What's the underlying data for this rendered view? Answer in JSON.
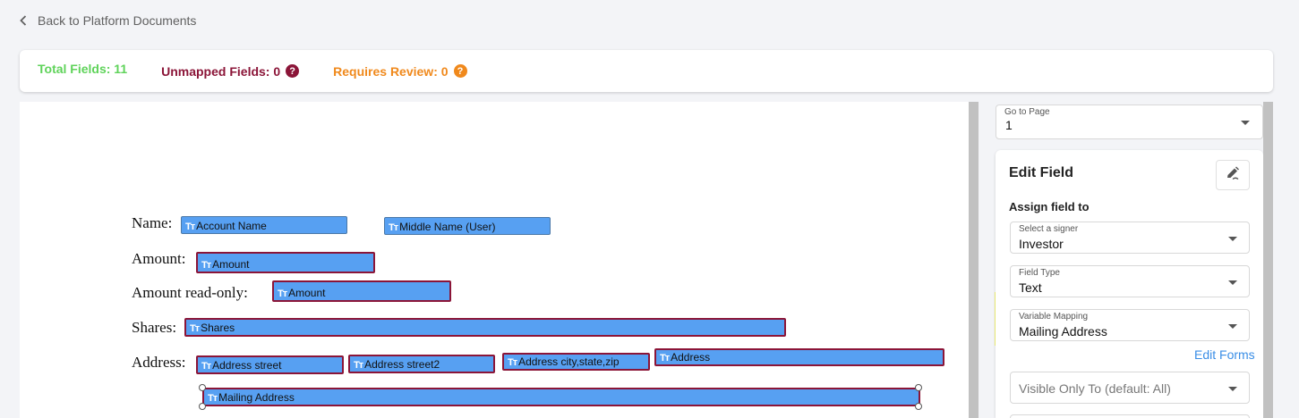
{
  "nav": {
    "back_label": "Back to Platform Documents"
  },
  "stats": {
    "total": "Total Fields: 11",
    "unmapped": "Unmapped Fields: 0",
    "review": "Requires Review: 0",
    "help_glyph": "?",
    "colors": {
      "total": "#5fd35a",
      "unmapped": "#8b1538",
      "review": "#f0891c"
    }
  },
  "document": {
    "labels": {
      "name": "Name:",
      "amount": "Amount:",
      "amount_readonly": "Amount read-only:",
      "shares": "Shares:",
      "address": "Address:"
    },
    "field_icon": "Tт",
    "fields": {
      "account_name": "Account Name",
      "middle_name": "Middle Name (User)",
      "amount": "Amount",
      "amount_readonly": "Amount",
      "shares": "Shares",
      "address_street": "Address street",
      "address_street2": "Address street2",
      "address_city": "Address city,state,zip",
      "address": "Address",
      "mailing_address": "Mailing Address"
    },
    "field_color": "#57a0f2",
    "field_border_color": "#8b1538"
  },
  "sidebar": {
    "goto": {
      "label": "Go to Page",
      "value": "1"
    },
    "edit": {
      "title": "Edit Field",
      "assign_label": "Assign field to",
      "signer": {
        "label": "Select a signer",
        "value": "Investor"
      },
      "field_type": {
        "label": "Field Type",
        "value": "Text"
      },
      "variable_mapping": {
        "label": "Variable Mapping",
        "value": "Mailing Address"
      },
      "edit_forms": "Edit Forms",
      "visible_only": {
        "placeholder": "Visible Only To (default: All)"
      }
    },
    "highlight_color": "#f6f57a",
    "link_color": "#3a8ee6"
  }
}
